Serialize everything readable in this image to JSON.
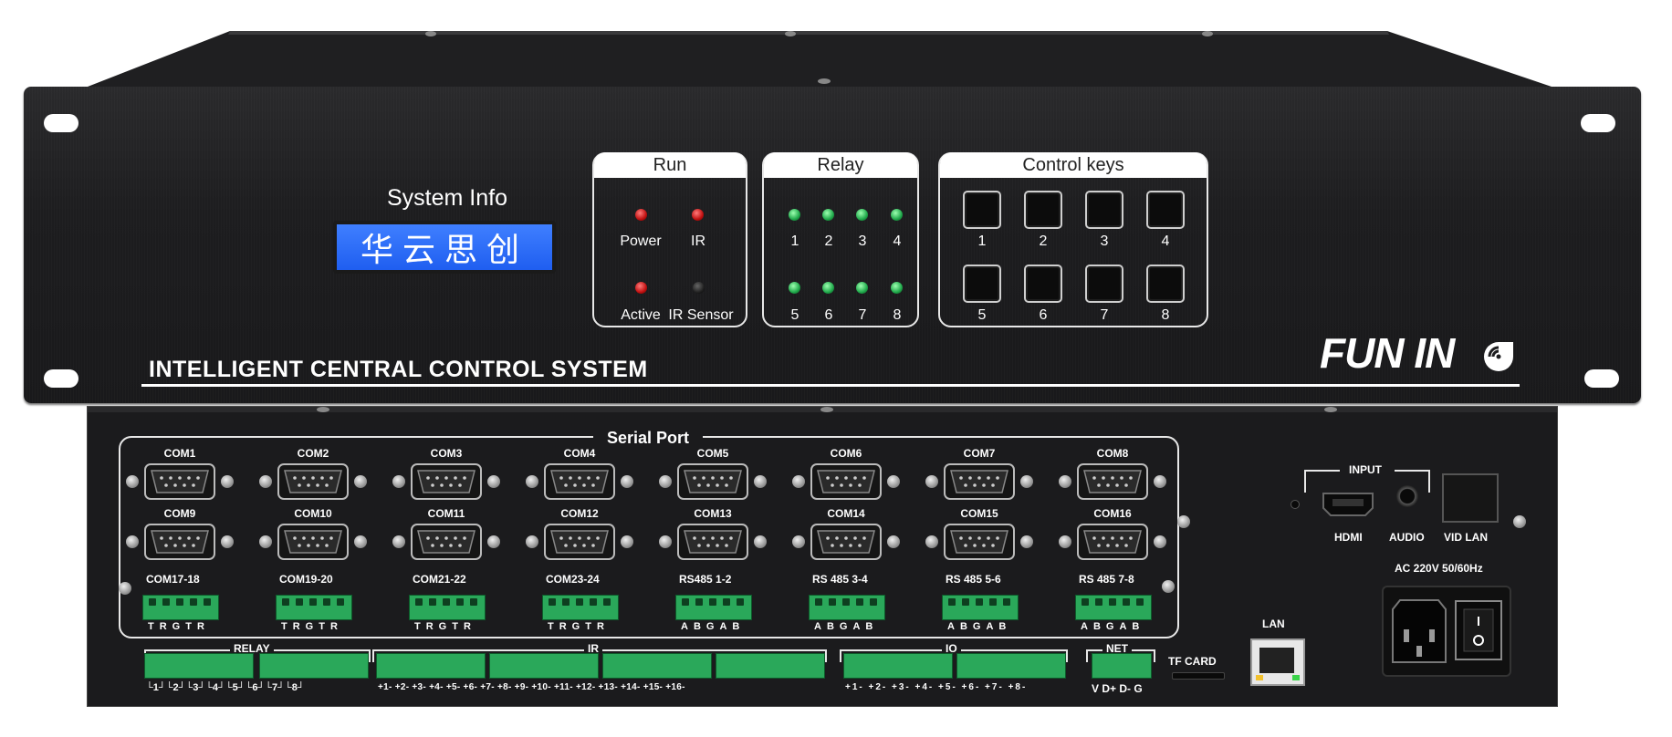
{
  "front": {
    "system_info_label": "System Info",
    "lcd_text": "华云思创",
    "run_panel": {
      "title": "Run",
      "indicators": [
        {
          "label": "Power",
          "state": "red"
        },
        {
          "label": "IR",
          "state": "red"
        },
        {
          "label": "Active",
          "state": "red"
        },
        {
          "label": "IR Sensor",
          "state": "off"
        }
      ]
    },
    "relay_panel": {
      "title": "Relay",
      "labels": [
        "1",
        "2",
        "3",
        "4",
        "5",
        "6",
        "7",
        "8"
      ]
    },
    "control_panel": {
      "title": "Control keys",
      "labels": [
        "1",
        "2",
        "3",
        "4",
        "5",
        "6",
        "7",
        "8"
      ]
    },
    "caption": "INTELLIGENT CENTRAL CONTROL SYSTEM",
    "brand": "FUN IN"
  },
  "rear": {
    "serial_title": "Serial Port",
    "com_row1": [
      "COM1",
      "COM2",
      "COM3",
      "COM4",
      "COM5",
      "COM6",
      "COM7",
      "COM8"
    ],
    "com_row2": [
      "COM9",
      "COM10",
      "COM11",
      "COM12",
      "COM13",
      "COM14",
      "COM15",
      "COM16"
    ],
    "terminal_blocks": [
      {
        "label": "COM17-18",
        "pins": "TRGTR"
      },
      {
        "label": "COM19-20",
        "pins": "TRGTR"
      },
      {
        "label": "COM21-22",
        "pins": "TRGTR"
      },
      {
        "label": "COM23-24",
        "pins": "TRGTR"
      },
      {
        "label": "RS485  1-2",
        "pins": "ABGAB"
      },
      {
        "label": "RS 485 3-4",
        "pins": "ABGAB"
      },
      {
        "label": "RS 485 5-6",
        "pins": "ABGAB"
      },
      {
        "label": "RS 485 7-8",
        "pins": "ABGAB"
      }
    ],
    "relay_group": {
      "title": "RELAY",
      "pins": "└1┘└2┘└3┘└4┘└5┘└6┘└7┘└8┘"
    },
    "ir_group": {
      "title": "IR",
      "pins": "+1- +2- +3- +4- +5- +6- +7- +8- +9- +10- +11- +12- +13- +14- +15- +16-"
    },
    "io_group": {
      "title": "IO",
      "pins": "+1- +2- +3- +4- +5- +6- +7- +8-"
    },
    "net_group": {
      "title": "NET",
      "pins": "V D+ D- G"
    },
    "tf_card": "TF  CARD",
    "lan": "LAN",
    "input_title": "INPUT",
    "hdmi": "HDMI",
    "audio": "AUDIO",
    "vid_lan": "VID  LAN",
    "power": "AC 220V  50/60Hz"
  },
  "colors": {
    "chassis": "#1d1d1f",
    "lcd": "#2a68f5",
    "terminal_green": "#2aa85a",
    "led_red": "#d01515",
    "led_green": "#1fa84a"
  }
}
